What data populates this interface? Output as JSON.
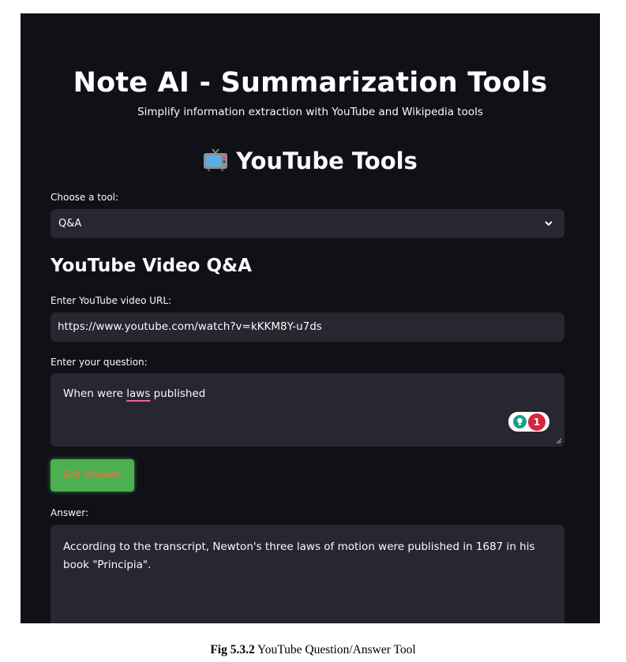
{
  "header": {
    "title": "Note AI - Summarization Tools",
    "subtitle": "Simplify information extraction with YouTube and Wikipedia tools"
  },
  "section": {
    "icon": "television-icon",
    "title": "YouTube Tools"
  },
  "tool_select": {
    "label": "Choose a tool:",
    "value": "Q&A"
  },
  "qa": {
    "heading": "YouTube Video Q&A",
    "url_label": "Enter YouTube video URL:",
    "url_value": "https://www.youtube.com/watch?v=kKKM8Y-u7ds",
    "question_label": "Enter your question:",
    "question_before": "When were ",
    "question_flagged_word": "laws",
    "question_after": " published",
    "grammar_badge_count": "1",
    "button_label": "Get Answer",
    "answer_label": "Answer:",
    "answer_text": "According to the transcript, Newton's three laws of motion were published in 1687 in his book \"Principia\"."
  },
  "caption": {
    "fig_number": "Fig 5.3.2",
    "text": " YouTube Question/Answer Tool"
  },
  "colors": {
    "background": "#0f1117",
    "input_background": "#262730",
    "button_green": "#4caf50",
    "button_text": "#ff6a40",
    "badge_red": "#d6263f",
    "badge_teal": "#15a08b"
  }
}
